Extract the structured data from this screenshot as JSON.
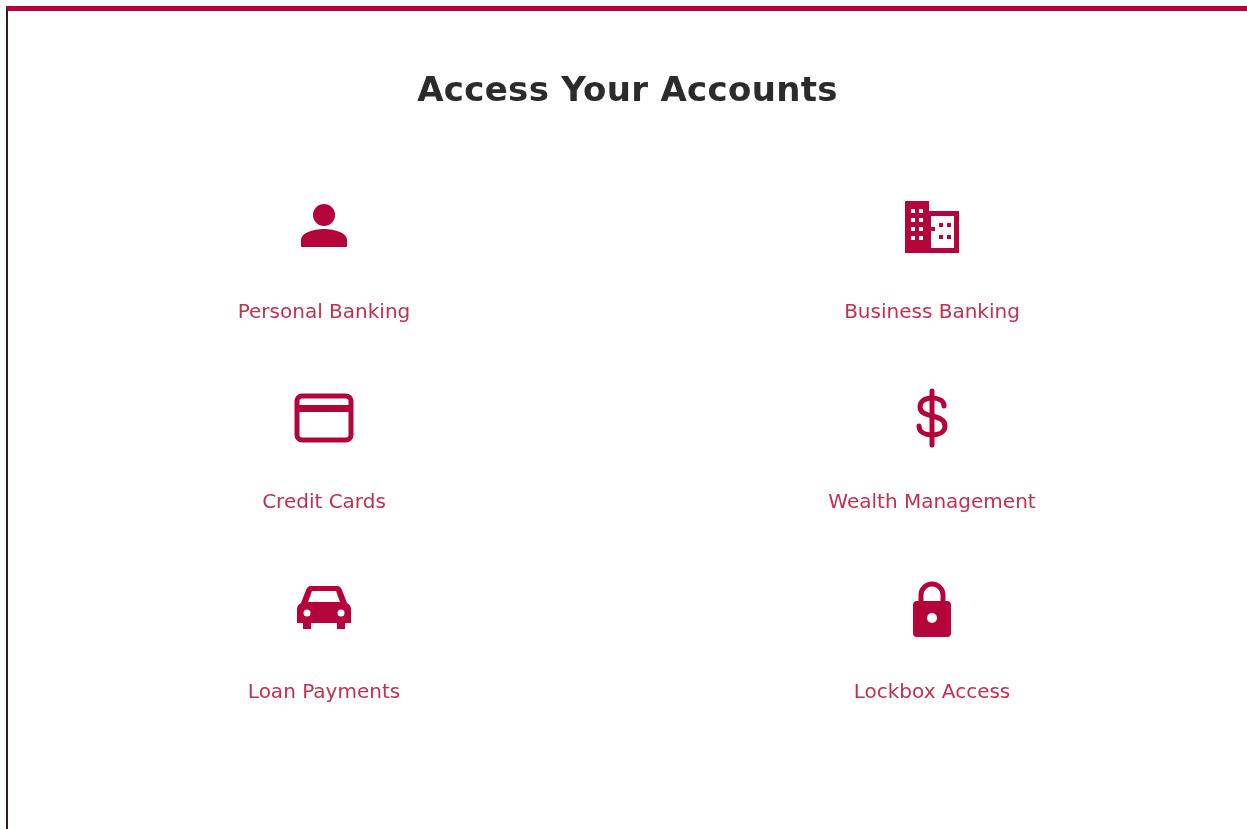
{
  "heading": "Access Your Accounts",
  "links": [
    {
      "kind": "person",
      "label": "Personal Banking"
    },
    {
      "kind": "building",
      "label": "Business Banking"
    },
    {
      "kind": "card",
      "label": "Credit Cards"
    },
    {
      "kind": "dollar",
      "label": "Wealth Management"
    },
    {
      "kind": "car",
      "label": "Loan Payments"
    },
    {
      "kind": "lock",
      "label": "Lockbox Access"
    }
  ]
}
